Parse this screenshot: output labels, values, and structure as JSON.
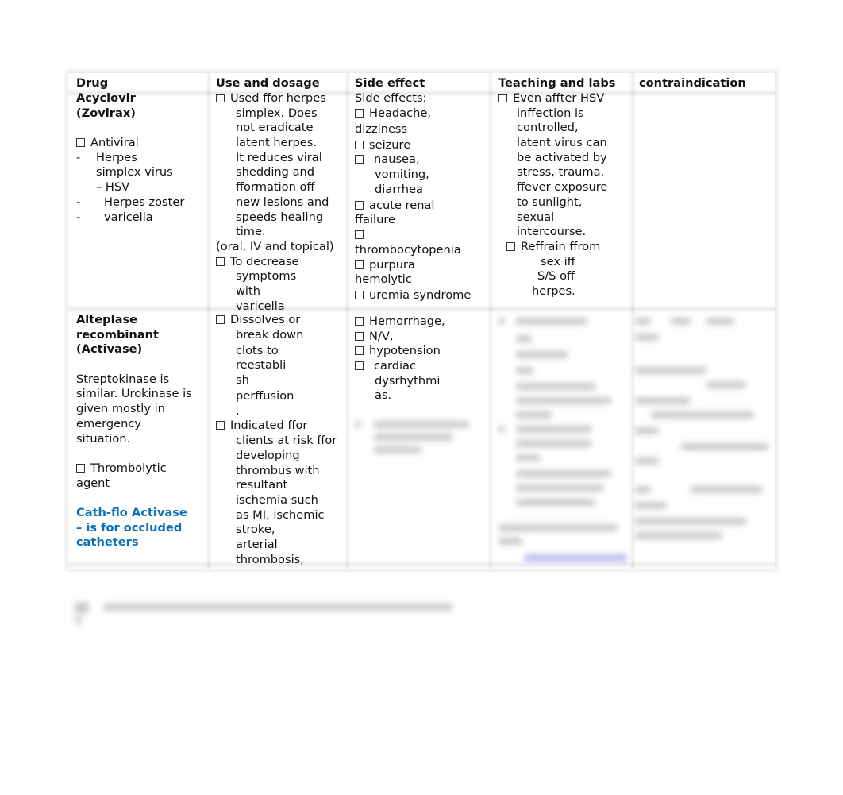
{
  "table": {
    "headers": [
      "Drug",
      "Use and dosage",
      "Side effect",
      "Teaching and labs",
      "contraindication"
    ],
    "rows": [
      {
        "drug": {
          "name_lines": [
            "Acyclovir",
            "(Zovirax)"
          ],
          "class_label": "Antiviral",
          "uses": [
            {
              "bullet": "-",
              "lines": [
                "Herpes",
                "simplex virus",
                "– HSV"
              ]
            },
            {
              "bullet": "-",
              "lines": [
                "Herpes zoster"
              ]
            },
            {
              "bullet": "-",
              "lines": [
                "varicella"
              ]
            }
          ]
        },
        "use_dosage": {
          "items": [
            {
              "lines": [
                "Used ffor herpes",
                "simplex. Does",
                "not eradicate",
                "latent herpes.",
                "It reduces viral",
                "shedding and",
                "fformation off",
                "new lesions and",
                "speeds healing",
                "time."
              ]
            }
          ],
          "route_note": "(oral, IV and topical)",
          "items2": [
            {
              "lines": [
                "To decrease",
                "symptoms",
                "with",
                "varicella"
              ]
            }
          ]
        },
        "side_effect": {
          "intro": "Side effects:",
          "items": [
            {
              "first": "Headache,",
              "rest": [
                "dizziness"
              ],
              "rest_indent": false
            },
            {
              "first": "seizure",
              "rest": [],
              "rest_indent": false
            },
            {
              "first": "nausea,",
              "rest": [
                "vomiting,",
                "diarrhea"
              ],
              "rest_indent": true
            },
            {
              "first": "acute renal",
              "rest": [
                "ffailure"
              ],
              "rest_indent": false
            },
            {
              "first": "",
              "rest": [
                "thrombocytopenia"
              ],
              "rest_indent": false
            },
            {
              "first": "purpura",
              "rest": [
                "hemolytic"
              ],
              "rest_indent": false
            },
            {
              "first": "uremia syndrome",
              "rest": [],
              "rest_indent": false
            }
          ]
        },
        "teaching": {
          "items": [
            {
              "lines": [
                "Even affter HSV",
                "inffection is",
                "controlled,",
                "latent virus can",
                "be activated by",
                "stress, trauma,",
                "ffever exposure",
                "to sunlight,",
                "sexual",
                "intercourse."
              ]
            },
            {
              "lines": [
                "Reffrain ffrom",
                "sex iff",
                "S/S off",
                "herpes."
              ]
            }
          ]
        },
        "contraindication": ""
      },
      {
        "drug": {
          "name_lines": [
            "Alteplase",
            "recombinant",
            "(Activase)"
          ],
          "note_lines": [
            "Streptokinase is",
            "similar. Urokinase is",
            "given mostly in",
            "emergency",
            "situation."
          ],
          "class_lines": [
            "Thrombolytic",
            "agent"
          ],
          "highlight_lines": [
            "Cath-flo Activase",
            "– is for occluded",
            "catheters"
          ]
        },
        "use_dosage": {
          "items": [
            {
              "lines": [
                "Dissolves or",
                "break down",
                "clots to",
                "reestabli",
                "sh",
                "perffusion",
                "."
              ]
            },
            {
              "lines": [
                "Indicated ffor",
                "clients at risk ffor",
                "developing",
                "thrombus with",
                "resultant",
                "ischemia such",
                "as MI, ischemic",
                "stroke,",
                "arterial",
                "thrombosis,"
              ]
            }
          ]
        },
        "side_effect": {
          "items": [
            {
              "lines": [
                "Hemorrhage,"
              ]
            },
            {
              "lines": [
                "N/V,"
              ]
            },
            {
              "lines": [
                "hypotension"
              ]
            },
            {
              "lines": [
                "cardiac",
                "dysrhythmi",
                "as."
              ]
            }
          ]
        },
        "teaching": {
          "obscured": true
        },
        "contraindication": {
          "obscured": true
        }
      }
    ]
  },
  "colors": {
    "highlight_text": "#0a6fb8",
    "body_text": "#111111"
  }
}
